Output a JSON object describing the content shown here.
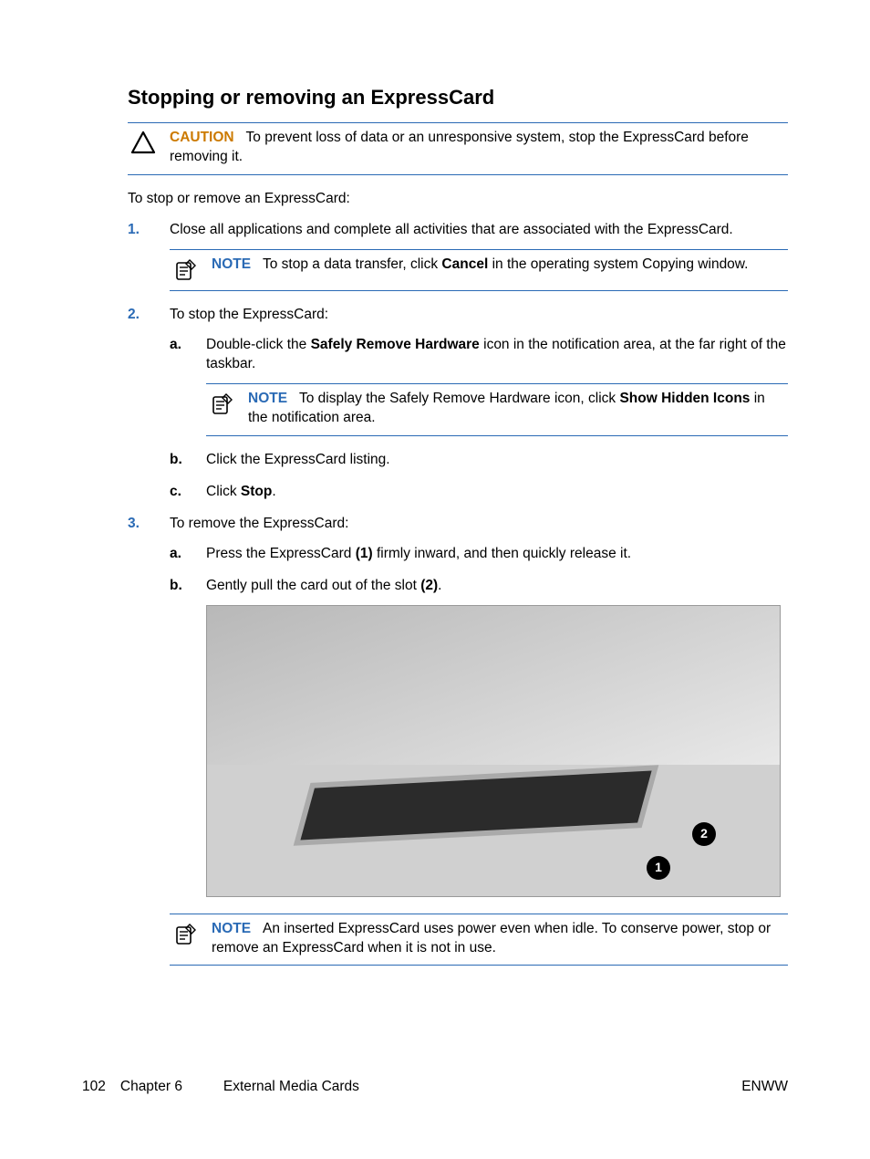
{
  "heading": "Stopping or removing an ExpressCard",
  "caution": {
    "label": "CAUTION",
    "text": "To prevent loss of data or an unresponsive system, stop the ExpressCard before removing it."
  },
  "intro": "To stop or remove an ExpressCard:",
  "steps": {
    "s1": {
      "marker": "1.",
      "text": "Close all applications and complete all activities that are associated with the ExpressCard.",
      "note_label": "NOTE",
      "note_before": "To stop a data transfer, click ",
      "note_bold": "Cancel",
      "note_after": " in the operating system Copying window."
    },
    "s2": {
      "marker": "2.",
      "text": "To stop the ExpressCard:",
      "a": {
        "marker": "a.",
        "before": "Double-click the ",
        "bold": "Safely Remove Hardware",
        "after": " icon in the notification area, at the far right of the taskbar.",
        "note_label": "NOTE",
        "note_before": "To display the Safely Remove Hardware icon, click ",
        "note_bold": "Show Hidden Icons",
        "note_after": " in the notification area."
      },
      "b": {
        "marker": "b.",
        "text": "Click the ExpressCard listing."
      },
      "c": {
        "marker": "c.",
        "before": "Click ",
        "bold": "Stop",
        "after": "."
      }
    },
    "s3": {
      "marker": "3.",
      "text": "To remove the ExpressCard:",
      "a": {
        "marker": "a.",
        "before": "Press the ExpressCard ",
        "bold": "(1)",
        "after": " firmly inward, and then quickly release it."
      },
      "b": {
        "marker": "b.",
        "before": "Gently pull the card out of the slot ",
        "bold": "(2)",
        "after": "."
      }
    }
  },
  "image_badges": {
    "b1": "1",
    "b2": "2"
  },
  "final_note": {
    "label": "NOTE",
    "text": "An inserted ExpressCard uses power even when idle. To conserve power, stop or remove an ExpressCard when it is not in use."
  },
  "footer": {
    "page": "102",
    "chapter": "Chapter 6",
    "title": "External Media Cards",
    "right": "ENWW"
  }
}
